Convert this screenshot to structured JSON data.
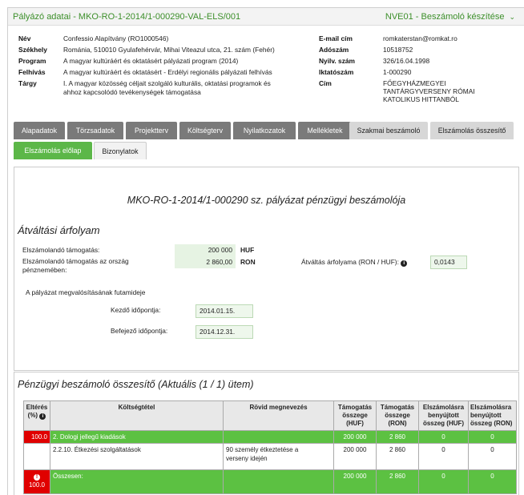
{
  "header": {
    "title": "Pályázó adatai - MKO-RO-1-2014/1-000290-VAL-ELS/001",
    "status": "NVE01 - Beszámoló készítése",
    "status_icon": "chevron-down-icon"
  },
  "info_left": [
    {
      "label": "Név",
      "value": "Confessio Alapítvány (RO1000546)"
    },
    {
      "label": "Székhely",
      "value": "Románia, 510010 Gyulafehérvár, Mihai Viteazul utca, 21. szám (Fehér)"
    },
    {
      "label": "Program",
      "value": "A magyar kultúráért és oktatásért pályázati program (2014)"
    },
    {
      "label": "Felhívás",
      "value": "A magyar kultúráért és oktatásért - Erdélyi regionális pályázati felhívás"
    },
    {
      "label": "Tárgy",
      "value_lines": [
        "I. A magyar közösség céljait szolgáló kulturális, oktatási programok és",
        "ahhoz kapcsolódó tevékenységek támogatása"
      ]
    }
  ],
  "info_right": [
    {
      "label": "E-mail cím",
      "value": "romkaterstan@romkat.ro"
    },
    {
      "label": "Adószám",
      "value": "10518752"
    },
    {
      "label": "Nyilv. szám",
      "value": "326/16.04.1998"
    },
    {
      "label": "Iktatószám",
      "value": "1-000290"
    },
    {
      "label": "Cím",
      "value_lines": [
        "FŐEGYHÁZMEGYEI",
        "TANTÁRGYVERSENY RÓMAI",
        "KATOLIKUS HITTANBÓL"
      ]
    }
  ],
  "tabs": [
    "Alapadatok",
    "Törzsadatok",
    "Projektterv",
    "Költségterv",
    "Nyilatkozatok",
    "Mellékletek",
    "Szakmai beszámoló",
    "Elszámolás összesítő"
  ],
  "subtabs": [
    "Elszámolás előlap",
    "Bizonylatok"
  ],
  "report": {
    "title": "MKO-RO-1-2014/1-000290 sz. pályázat pénzügyi beszámolója",
    "section1": "Átváltási árfolyam",
    "support_label": "Elszámolandó támogatás:",
    "support_value": "200 000",
    "support_unit": "HUF",
    "support_local_label_1": "Elszámolandó támogatás az ország",
    "support_local_label_2": "pénznemében:",
    "support_local_value": "2 860,00",
    "support_local_unit": "RON",
    "rate_label": "Átváltás árfolyama (RON / HUF):",
    "rate_value": "0,0143",
    "period_label": "A pályázat megvalósításának futamideje",
    "start_label": "Kezdő időpontja:",
    "start_value": "2014.01.15.",
    "end_label": "Befejező időpontja:",
    "end_value": "2014.12.31."
  },
  "summary": {
    "title": "Pénzügyi beszámoló összesítő (Aktuális (1 / 1) ütem)",
    "columns": {
      "diff": "Eltérés (%)",
      "cost": "Költségtétel",
      "short": "Rövid megnevezés",
      "huf": [
        "Támogatás",
        "összege",
        "(HUF)"
      ],
      "ron": [
        "Támogatás",
        "összege",
        "(RON)"
      ],
      "claim_huf": [
        "Elszámolásra",
        "benyújtott",
        "összeg (HUF)"
      ],
      "claim_ron": [
        "Elszámolásra",
        "benyújtott",
        "összeg (RON)"
      ]
    },
    "rows": [
      {
        "diff": "100.0",
        "cost": "2. Dologi jellegű kiadások",
        "short": "",
        "huf": "200 000",
        "ron": "2 860",
        "claim_huf": "0",
        "claim_ron": "0"
      },
      {
        "diff": "",
        "cost": "2.2.10. Étkezési szolgáltatások",
        "short_lines": [
          "90 személy étkeztetése a",
          "verseny idején"
        ],
        "huf": "200 000",
        "ron": "2 860",
        "claim_huf": "0",
        "claim_ron": "0"
      },
      {
        "diff": "100.0",
        "cost": "Összesen:",
        "short": "",
        "huf": "200 000",
        "ron": "2 860",
        "claim_huf": "0",
        "claim_ron": "0"
      }
    ]
  },
  "colors": {
    "accent": "#5cb748",
    "danger": "#e00000",
    "tab_dark": "#7a7a7a"
  }
}
